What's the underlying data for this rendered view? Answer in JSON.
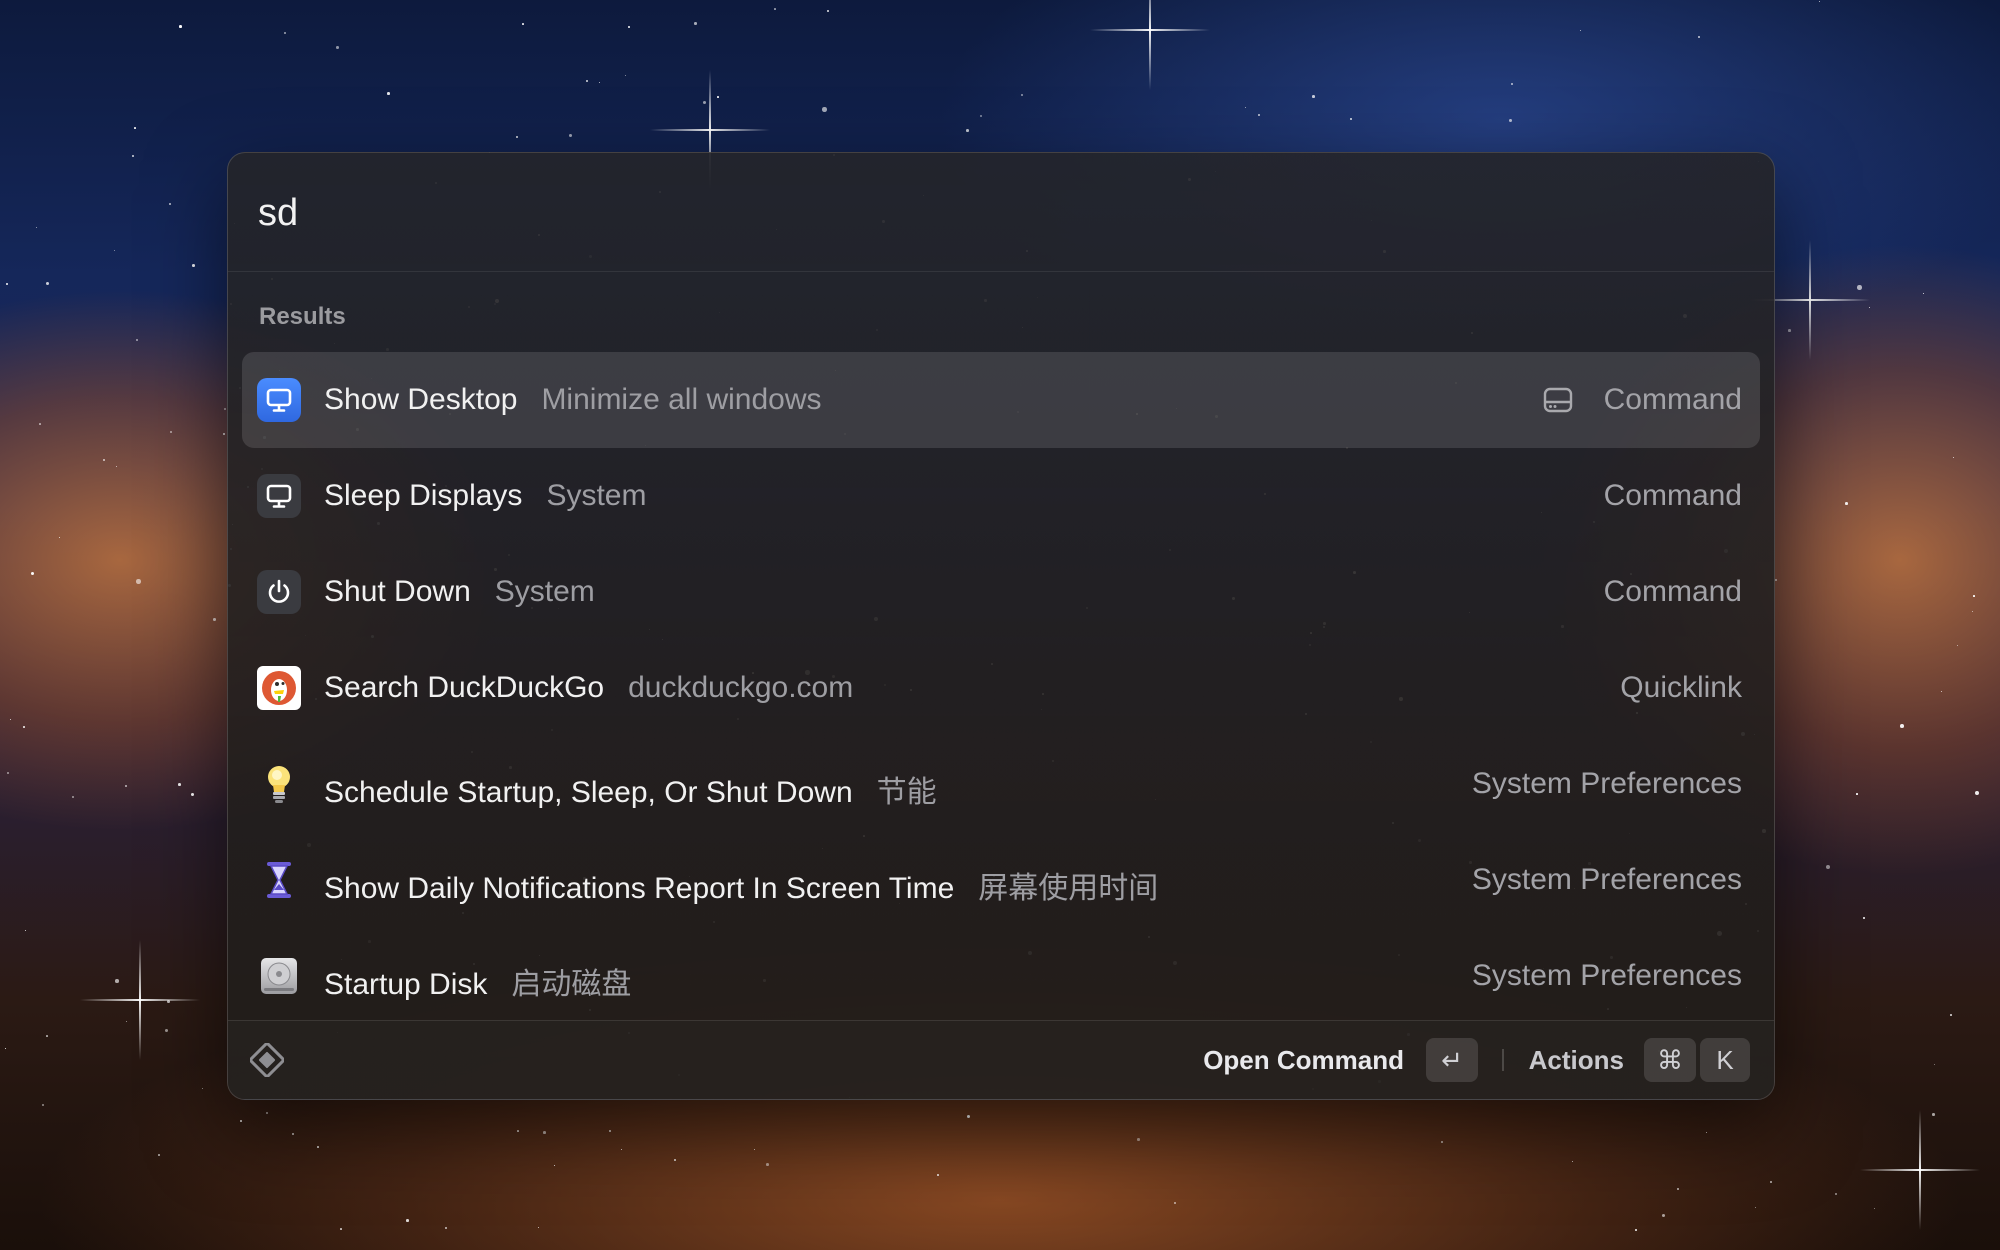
{
  "search": {
    "query": "sd"
  },
  "results_section": {
    "label": "Results"
  },
  "results": [
    {
      "title": "Show Desktop",
      "subtitle": "Minimize all windows",
      "kind": "Command",
      "icon": "desktop-icon",
      "selected": true
    },
    {
      "title": "Sleep Displays",
      "subtitle": "System",
      "kind": "Command",
      "icon": "display-icon",
      "selected": false
    },
    {
      "title": "Shut Down",
      "subtitle": "System",
      "kind": "Command",
      "icon": "power-icon",
      "selected": false
    },
    {
      "title": "Search DuckDuckGo",
      "subtitle": "duckduckgo.com",
      "kind": "Quicklink",
      "icon": "duckduckgo-icon",
      "selected": false
    },
    {
      "title": "Schedule Startup, Sleep, Or Shut Down",
      "subtitle": "节能",
      "kind": "System Preferences",
      "icon": "lightbulb-icon",
      "selected": false
    },
    {
      "title": "Show Daily Notifications Report In Screen Time",
      "subtitle": "屏幕使用时间",
      "kind": "System Preferences",
      "icon": "hourglass-icon",
      "selected": false
    },
    {
      "title": "Startup Disk",
      "subtitle": "启动磁盘",
      "kind": "System Preferences",
      "icon": "disk-icon",
      "selected": false
    }
  ],
  "footer": {
    "primary_action": "Open Command",
    "primary_key": "↵",
    "actions_label": "Actions",
    "actions_keys": [
      "⌘",
      "K"
    ]
  },
  "colors": {
    "accent_blue": "#3b7cf5",
    "text_primary": "#f1f1f1",
    "text_secondary": "#9e9ea3"
  }
}
